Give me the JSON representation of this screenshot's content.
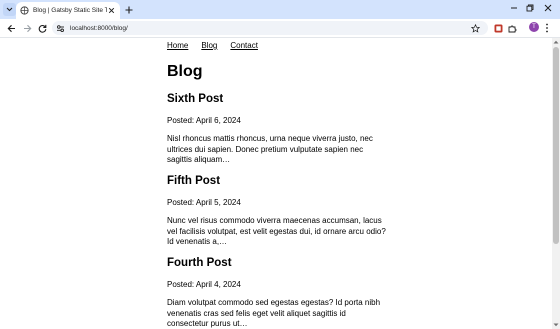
{
  "browser": {
    "tab": {
      "title": "Blog | Gatsby Static Site Tutorial"
    },
    "address_bar": {
      "url": "localhost:8000/blog/"
    },
    "profile_initial": "T",
    "colors": {
      "tabstrip": "#d3e3fd",
      "omnibox": "#f0f3f8",
      "avatar": "#8e44ad",
      "extension": "#c0392b"
    }
  },
  "site": {
    "nav": [
      {
        "label": "Home"
      },
      {
        "label": "Blog"
      },
      {
        "label": "Contact"
      }
    ],
    "page_title": "Blog",
    "posts": [
      {
        "title": "Sixth Post",
        "date": "Posted: April 6, 2024",
        "excerpt": "Nisl rhoncus mattis rhoncus, urna neque viverra justo, nec ultrices dui sapien. Donec pretium vulputate sapien nec sagittis aliquam…"
      },
      {
        "title": "Fifth Post",
        "date": "Posted: April 5, 2024",
        "excerpt": "Nunc vel risus commodo viverra maecenas accumsan, lacus vel facilisis volutpat, est velit egestas dui, id ornare arcu odio? Id venenatis a,…"
      },
      {
        "title": "Fourth Post",
        "date": "Posted: April 4, 2024",
        "excerpt": "Diam volutpat commodo sed egestas egestas? Id porta nibh venenatis cras sed felis eget velit aliquet sagittis id consectetur purus ut…"
      }
    ]
  }
}
